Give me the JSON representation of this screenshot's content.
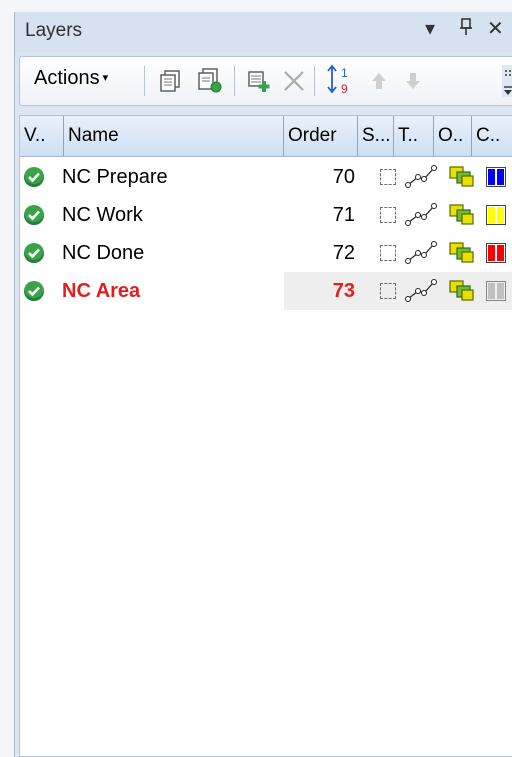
{
  "panel": {
    "title": "Layers",
    "controls": {
      "dropdown": "▾",
      "pin": "ᚎ",
      "close": "✕"
    }
  },
  "toolbar": {
    "actions_label": "Actions",
    "actions_caret": "▾",
    "sort_top": "1",
    "sort_bottom": "9"
  },
  "columns": [
    {
      "label": "V.."
    },
    {
      "label": "Name"
    },
    {
      "label": "Order"
    },
    {
      "label": "S..."
    },
    {
      "label": "T.."
    },
    {
      "label": "O.."
    },
    {
      "label": "C.."
    }
  ],
  "rows": [
    {
      "name": "NC Prepare",
      "order": "70",
      "color": "#0000ff",
      "selected": false
    },
    {
      "name": "NC Work",
      "order": "71",
      "color": "#ffff00",
      "selected": false
    },
    {
      "name": "NC Done",
      "order": "72",
      "color": "#ff0000",
      "selected": false
    },
    {
      "name": "NC Area",
      "order": "73",
      "color": "#c0c0c0",
      "selected": true
    }
  ],
  "colors": {
    "selected_text": "#e02020",
    "check_green": "#3aa34a",
    "header_blue": "#cfdff3"
  }
}
